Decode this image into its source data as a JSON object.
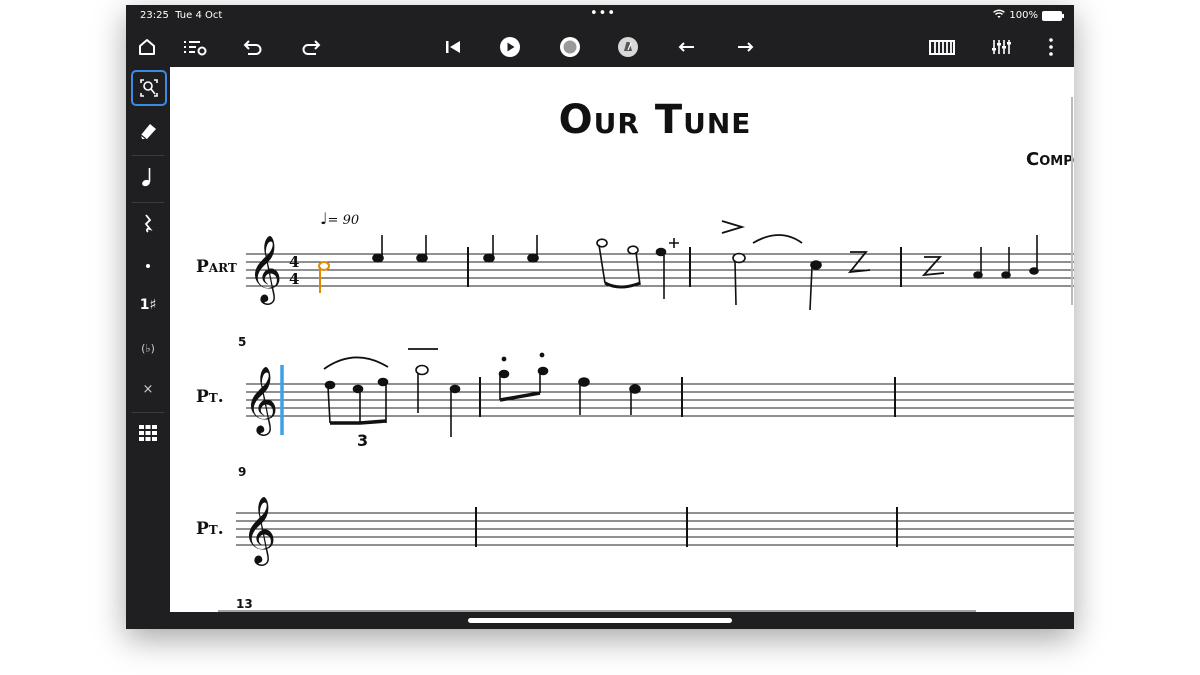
{
  "status_bar": {
    "time": "23:25",
    "date": "Tue 4 Oct",
    "battery": "100%",
    "battery_level": 1.0
  },
  "toolbar": {
    "icons": [
      "home-icon",
      "playlist-settings-icon",
      "undo-icon",
      "redo-icon",
      "rewind-to-start-icon",
      "play-icon",
      "record-icon",
      "metronome-icon",
      "arrow-left-icon",
      "arrow-right-icon",
      "keyboard-icon",
      "mixer-icon",
      "more-icon"
    ]
  },
  "sidebar": {
    "tools": [
      "selection-tool-icon",
      "eraser-icon",
      "note-icon",
      "rest-icon",
      "dot-icon",
      "tuplet-icon",
      "parentheses-icon",
      "double-sharp-icon",
      "grid-icon"
    ],
    "tuplet_label": "1♯",
    "paren_label": "(♭)",
    "x_label": "×"
  },
  "score": {
    "title": "Our Tune",
    "composer": "Compo",
    "tempo": "= 90",
    "time_signature": {
      "top": "4",
      "bottom": "4"
    },
    "systems": [
      {
        "label": "Part",
        "measure_number": ""
      },
      {
        "label": "Pt.",
        "measure_number": "5"
      },
      {
        "label": "Pt.",
        "measure_number": "9"
      },
      {
        "label": "",
        "measure_number": "13"
      }
    ],
    "triplet_label": "3"
  },
  "colors": {
    "selected_note": "#e08a00",
    "cursor": "#3ea0e8",
    "selection_border": "#3a8be6",
    "chrome": "#1f1f21"
  }
}
